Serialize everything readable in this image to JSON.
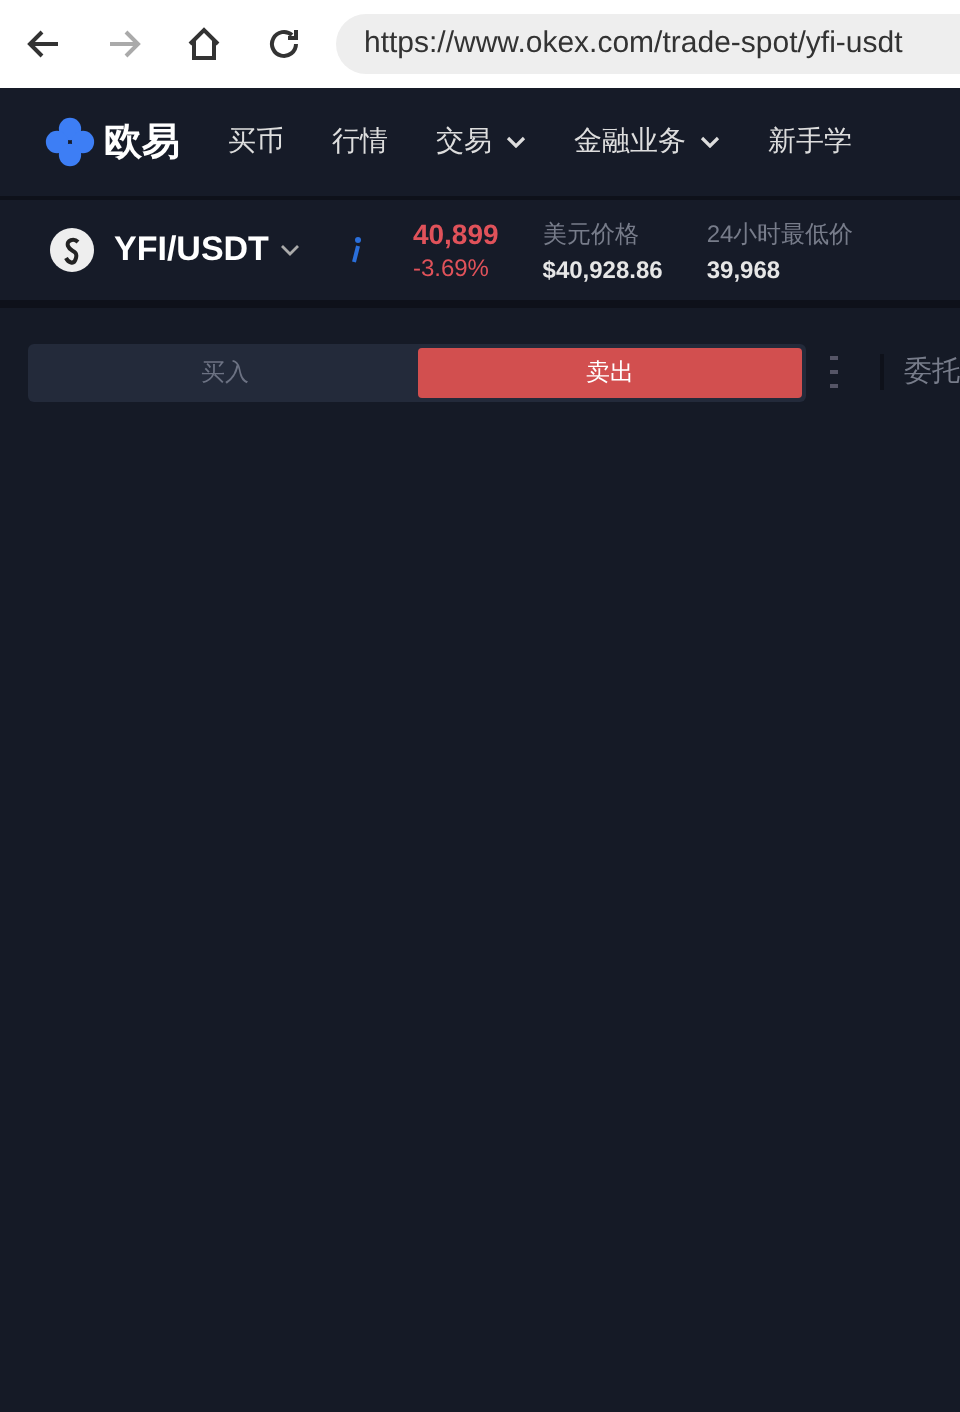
{
  "browser": {
    "url": "https://www.okex.com/trade-spot/yfi-usdt"
  },
  "nav": {
    "logo": "欧易",
    "items": [
      {
        "label": "买币",
        "dropdown": false
      },
      {
        "label": "行情",
        "dropdown": false
      },
      {
        "label": "交易",
        "dropdown": true
      },
      {
        "label": "金融业务",
        "dropdown": true
      },
      {
        "label": "新手学",
        "dropdown": false
      }
    ]
  },
  "ticker": {
    "pair": "YFI/USDT",
    "price": "40,899",
    "change": "-3.69%",
    "stats": [
      {
        "label": "美元价格",
        "value": "$40,928.86"
      },
      {
        "label": "24小时最低价",
        "value": "39,968"
      }
    ]
  },
  "trade_tabs": [
    {
      "label": "买入",
      "selected": false
    },
    {
      "label": "卖出",
      "selected": true
    }
  ],
  "orders_tab": "委托"
}
